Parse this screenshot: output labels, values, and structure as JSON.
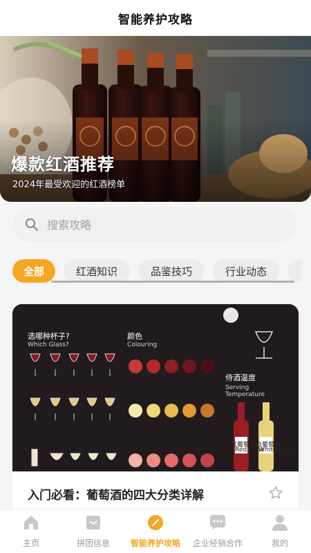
{
  "header": {
    "title": "智能养护攻略"
  },
  "banner": {
    "title": "爆款红酒推荐",
    "subtitle": "2024年最受欢迎的红酒榜单"
  },
  "search": {
    "placeholder": "搜索攻略"
  },
  "tabs": [
    {
      "label": "全部",
      "active": true
    },
    {
      "label": "红酒知识",
      "active": false
    },
    {
      "label": "品鉴技巧",
      "active": false
    },
    {
      "label": "行业动态",
      "active": false
    }
  ],
  "article": {
    "title": "入门必看：葡萄酒的四大分类详解",
    "infographic": {
      "glass_heading": "选哪种杯子?",
      "glass_heading_en": "Which Glass?",
      "colour_heading": "颜色",
      "colour_heading_en": "Colouring",
      "temp_heading": "侍酒温度",
      "temp_heading_en": "Serving Temperature",
      "red_bottle_label": "红葡萄酒",
      "red_bottle_label_en": "Red Wine",
      "white_bottle_label": "白葡萄酒",
      "white_bottle_label_en": "White Wine"
    }
  },
  "bottom_nav": [
    {
      "label": "主页",
      "icon": "home-icon",
      "active": false
    },
    {
      "label": "拼团信息",
      "icon": "group-buy-icon",
      "active": false
    },
    {
      "label": "智能养护攻略",
      "icon": "guide-icon",
      "active": true
    },
    {
      "label": "企业经销合作",
      "icon": "chat-icon",
      "active": false
    },
    {
      "label": "我的",
      "icon": "user-icon",
      "active": false
    }
  ],
  "colors": {
    "accent": "#f5a623",
    "inactive_tab": "#ececec",
    "nav_inactive": "#999999"
  }
}
